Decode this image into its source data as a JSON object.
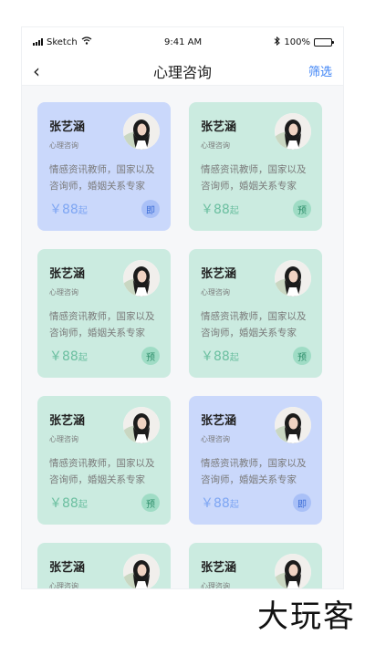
{
  "status_bar": {
    "carrier": "Sketch",
    "time": "9:41 AM",
    "battery_percent": "100%",
    "icons": [
      "signal-icon",
      "wifi-icon",
      "bluetooth-icon",
      "battery-icon"
    ]
  },
  "nav": {
    "back_icon": "‹",
    "title": "心理咨询",
    "filter_label": "筛选"
  },
  "colors": {
    "green_card": "#cbebe0",
    "blue_card": "#cad8fb",
    "accent_blue": "#3b82f6",
    "green_price": "#6bbfa0",
    "blue_price": "#7ea6f3"
  },
  "cards": [
    {
      "name": "张艺涵",
      "role": "心理咨询",
      "desc": "情感资讯教师，国家以及咨询师，婚姻关系专家",
      "price": "￥88",
      "price_suffix": "起",
      "badge": "即",
      "theme": "blue"
    },
    {
      "name": "张艺涵",
      "role": "心理咨询",
      "desc": "情感资讯教师，国家以及咨询师，婚姻关系专家",
      "price": "￥88",
      "price_suffix": "起",
      "badge": "预",
      "theme": "green"
    },
    {
      "name": "张艺涵",
      "role": "心理咨询",
      "desc": "情感资讯教师，国家以及咨询师，婚姻关系专家",
      "price": "￥88",
      "price_suffix": "起",
      "badge": "预",
      "theme": "green"
    },
    {
      "name": "张艺涵",
      "role": "心理咨询",
      "desc": "情感资讯教师，国家以及咨询师，婚姻关系专家",
      "price": "￥88",
      "price_suffix": "起",
      "badge": "预",
      "theme": "green"
    },
    {
      "name": "张艺涵",
      "role": "心理咨询",
      "desc": "情感资讯教师，国家以及咨询师，婚姻关系专家",
      "price": "￥88",
      "price_suffix": "起",
      "badge": "预",
      "theme": "green"
    },
    {
      "name": "张艺涵",
      "role": "心理咨询",
      "desc": "情感资讯教师，国家以及咨询师，婚姻关系专家",
      "price": "￥88",
      "price_suffix": "起",
      "badge": "即",
      "theme": "blue"
    },
    {
      "name": "张艺涵",
      "role": "心理咨询",
      "desc": "",
      "price": "",
      "price_suffix": "",
      "badge": "",
      "theme": "green"
    },
    {
      "name": "张艺涵",
      "role": "心理咨询",
      "desc": "",
      "price": "",
      "price_suffix": "",
      "badge": "",
      "theme": "green"
    }
  ],
  "watermark": "大玩客"
}
